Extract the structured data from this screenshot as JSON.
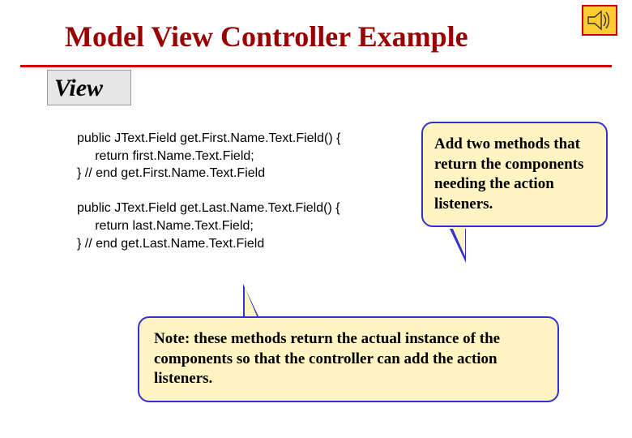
{
  "title": "Model View Controller Example",
  "view_label": "View",
  "code": "public JText.Field get.First.Name.Text.Field() {\n     return first.Name.Text.Field;\n} // end get.First.Name.Text.Field\n\npublic JText.Field get.Last.Name.Text.Field() {\n     return last.Name.Text.Field;\n} // end get.Last.Name.Text.Field",
  "callout_right": "Add two methods that return the components needing the action listeners.",
  "callout_bottom": "Note: these methods return the actual instance of the components so that the controller can add the action listeners.",
  "icons": {
    "speaker": "speaker-icon"
  }
}
